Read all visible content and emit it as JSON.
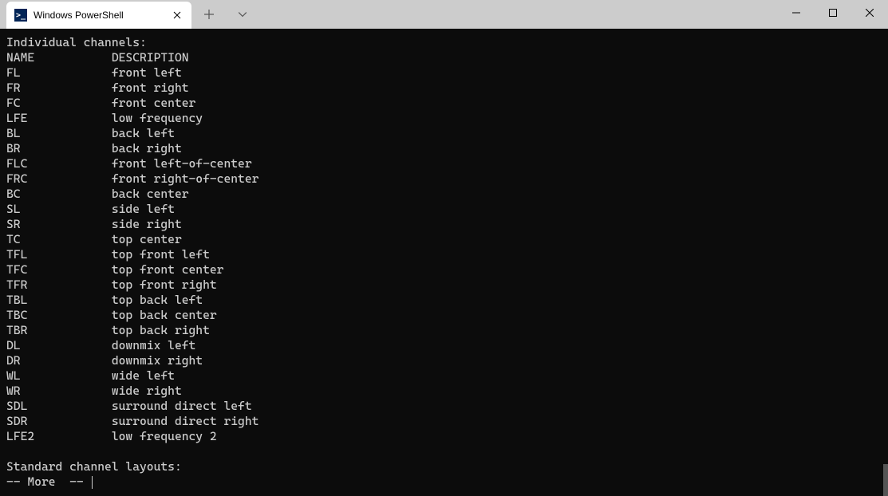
{
  "tab": {
    "title": "Windows PowerShell",
    "icon_glyph": ">_"
  },
  "terminal": {
    "header": "Individual channels:",
    "col1": "NAME",
    "col2": "DESCRIPTION",
    "channels": [
      {
        "name": "FL",
        "desc": "front left"
      },
      {
        "name": "FR",
        "desc": "front right"
      },
      {
        "name": "FC",
        "desc": "front center"
      },
      {
        "name": "LFE",
        "desc": "low frequency"
      },
      {
        "name": "BL",
        "desc": "back left"
      },
      {
        "name": "BR",
        "desc": "back right"
      },
      {
        "name": "FLC",
        "desc": "front left-of-center"
      },
      {
        "name": "FRC",
        "desc": "front right-of-center"
      },
      {
        "name": "BC",
        "desc": "back center"
      },
      {
        "name": "SL",
        "desc": "side left"
      },
      {
        "name": "SR",
        "desc": "side right"
      },
      {
        "name": "TC",
        "desc": "top center"
      },
      {
        "name": "TFL",
        "desc": "top front left"
      },
      {
        "name": "TFC",
        "desc": "top front center"
      },
      {
        "name": "TFR",
        "desc": "top front right"
      },
      {
        "name": "TBL",
        "desc": "top back left"
      },
      {
        "name": "TBC",
        "desc": "top back center"
      },
      {
        "name": "TBR",
        "desc": "top back right"
      },
      {
        "name": "DL",
        "desc": "downmix left"
      },
      {
        "name": "DR",
        "desc": "downmix right"
      },
      {
        "name": "WL",
        "desc": "wide left"
      },
      {
        "name": "WR",
        "desc": "wide right"
      },
      {
        "name": "SDL",
        "desc": "surround direct left"
      },
      {
        "name": "SDR",
        "desc": "surround direct right"
      },
      {
        "name": "LFE2",
        "desc": "low frequency 2"
      }
    ],
    "footer": "Standard channel layouts:",
    "more_prompt": "-- More  -- "
  }
}
